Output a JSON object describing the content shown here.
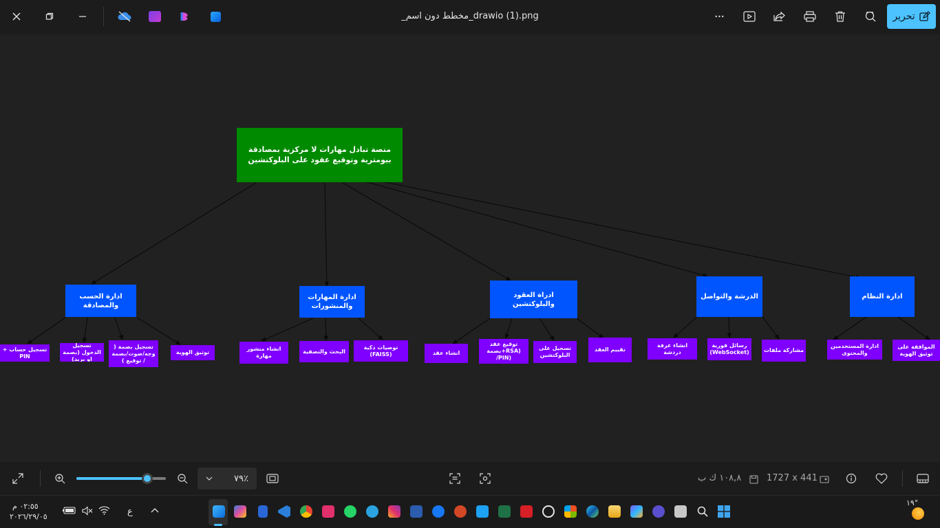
{
  "window": {
    "title": "_مخطط دون اسم_drawio (1).png",
    "edit_label": "تحرير",
    "more_label": "···"
  },
  "diagram": {
    "root": "منصة تبادل مهارات لا مركزية بمصادقة بيومترية وتوقيع عقود على البلوكتشين",
    "categories": [
      {
        "label": "ادارة الحسب والمصادقة"
      },
      {
        "label": "ادارة المهارات والمنشورات"
      },
      {
        "label": "ادراة العقود والبلوكتشين"
      },
      {
        "label": "الدرشة والتواصل"
      },
      {
        "label": "ادارة النظام"
      }
    ],
    "leaves": [
      {
        "label": "+ تسجيل حساب PIN"
      },
      {
        "label": "تسجيل الدخول (بصمة او بريد)"
      },
      {
        "label": "تسجيل بصمة ( وجه/صوت/بصمة / توقيع )"
      },
      {
        "label": "توثيق الهوية"
      },
      {
        "label": "انشاء منشور مهارة"
      },
      {
        "label": "البحث والتصفية"
      },
      {
        "label": "توصيات ذكية (FAISS)"
      },
      {
        "label": "انشاء عقد"
      },
      {
        "label": "توقيع عقد بصمة+RSA) /PIN)"
      },
      {
        "label": "تسجيل على البلوكتشين"
      },
      {
        "label": "تقييم العقد"
      },
      {
        "label": "انشاء غرفة دردشة"
      },
      {
        "label": "رسائل فورية (WebSocket)"
      },
      {
        "label": "مشاركة ملفات"
      },
      {
        "label": "ادارة المستخدمين والمحتوى"
      },
      {
        "label": "الموافقة على توثيق الهوية"
      }
    ]
  },
  "viewer": {
    "zoom_value": "٧٩٪",
    "zoom_fraction": 0.79,
    "dimensions": "1727 x 441",
    "file_size": "١٠٨,٨ ك ب"
  },
  "taskbar": {
    "time": "٠٢:٥٥ م",
    "date": "٢٠٢٦/٢٩/٠٥",
    "language": "ع",
    "weather": "١٩°"
  },
  "colors": {
    "root": "#008a00",
    "category": "#0055ff",
    "leaf": "#7f00ff",
    "accent": "#4cc2ff"
  }
}
